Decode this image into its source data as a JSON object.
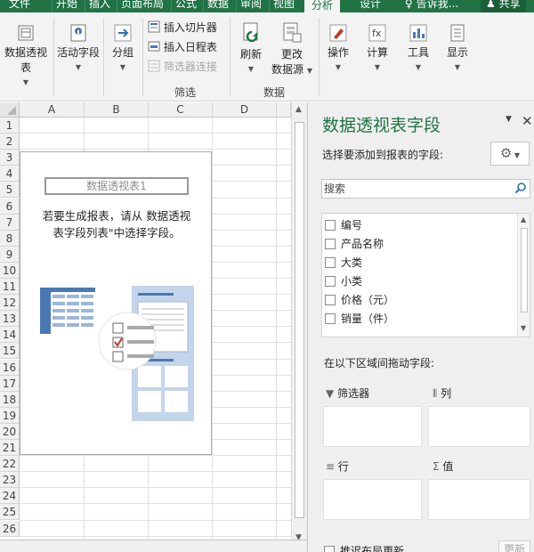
{
  "tabs": [
    {
      "label": "文件"
    },
    {
      "label": "开始"
    },
    {
      "label": "插入"
    },
    {
      "label": "页面布局"
    },
    {
      "label": "公式"
    },
    {
      "label": "数据"
    },
    {
      "label": "审阅"
    },
    {
      "label": "视图"
    },
    {
      "label": "分析"
    },
    {
      "label": "设计"
    },
    {
      "label": "告诉我..."
    },
    {
      "label": "共享"
    }
  ],
  "ribbon": {
    "pivot_table": "数据透视表",
    "active_field": "活动字段",
    "group": "分组",
    "insert_slicer": "插入切片器",
    "insert_timeline": "插入日程表",
    "filter_connections": "筛选器连接",
    "filter_group": "筛选",
    "refresh": "刷新",
    "change_source_1": "更改",
    "change_source_2": "数据源",
    "data_group": "数据",
    "actions": "操作",
    "calculations": "计算",
    "tools": "工具",
    "show": "显示"
  },
  "sheet": {
    "columns": [
      "A",
      "B",
      "C",
      "D"
    ],
    "rows": [
      "1",
      "2",
      "3",
      "4",
      "5",
      "6",
      "7",
      "8",
      "9",
      "10",
      "11",
      "12",
      "13",
      "14",
      "15",
      "16",
      "17",
      "18",
      "19",
      "20",
      "21",
      "22",
      "23",
      "24",
      "25",
      "26"
    ],
    "pivot_title": "数据透视表1",
    "pivot_msg_line1": "若要生成报表，请从 数据透视",
    "pivot_msg_line2": "表字段列表\"中选择字段。"
  },
  "pane": {
    "title": "数据透视表字段",
    "subtitle": "选择要添加到报表的字段:",
    "search_placeholder": "搜索",
    "fields": [
      "编号",
      "产品名称",
      "大类",
      "小类",
      "价格（元）",
      "销量（件）"
    ],
    "areas_label": "在以下区域间拖动字段:",
    "filters": "筛选器",
    "columns": "列",
    "rows": "行",
    "values": "值",
    "defer_label": "推迟布局更新",
    "update_button": "更新"
  },
  "colors": {
    "excel_green": "#217346",
    "accent_blue": "#4a78b5"
  }
}
